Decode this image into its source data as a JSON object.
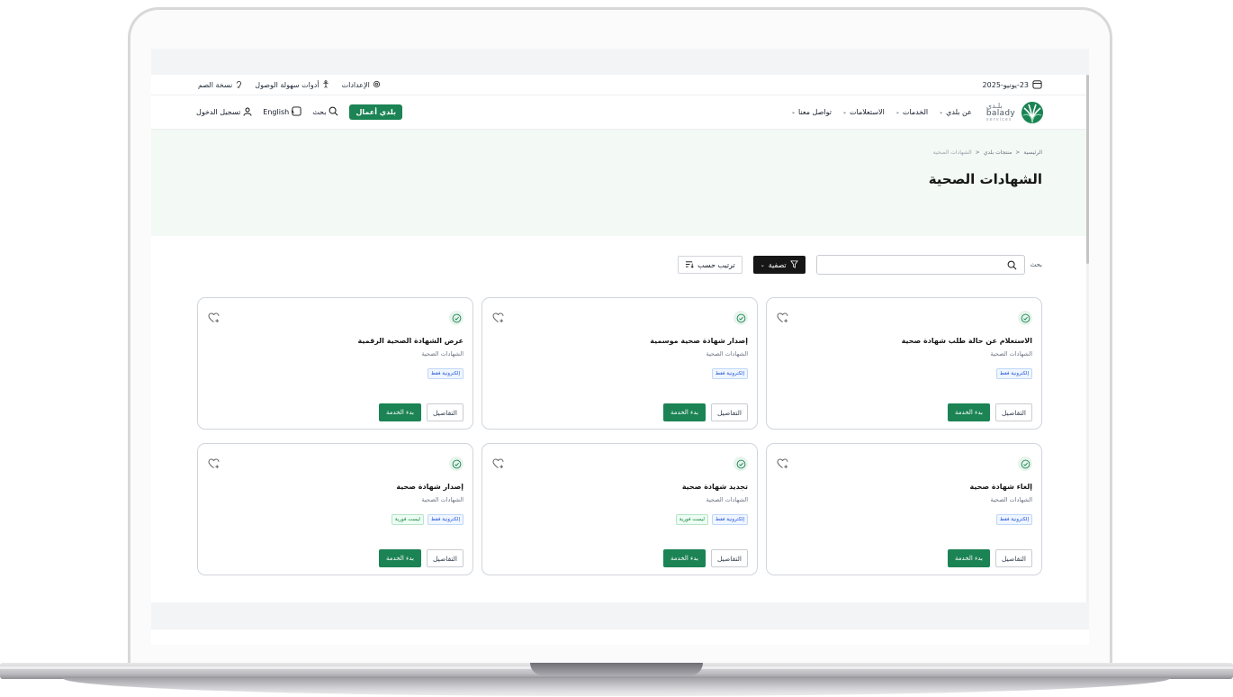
{
  "utility": {
    "date": "23-يونيو-2025",
    "settings": "الإعدادات",
    "accessibility": "أدوات سهولة الوصول",
    "screen_reader": "نسخة الصم"
  },
  "logo": {
    "ar": "بلـدي",
    "en": "balady",
    "sub": "services"
  },
  "nav": {
    "items": [
      {
        "label": "عن بلدي"
      },
      {
        "label": "الخدمات"
      },
      {
        "label": "الاستعلامات"
      },
      {
        "label": "تواصل معنا"
      }
    ],
    "business_button": "بلدي أعمال",
    "search": "بحث",
    "language": "English",
    "login": "تسجيل الدخول"
  },
  "breadcrumb": {
    "home": "الرئيسية",
    "products": "منتجات بلدي",
    "current": "الشهادات الصحية",
    "sep": "<"
  },
  "page_title": "الشهادات الصحية",
  "toolbar": {
    "search_label": "بحث",
    "search_placeholder": "",
    "filter": "تصفية",
    "sort": "ترتيب حسب"
  },
  "cards": [
    {
      "title": "الاستعلام عن حالة طلب شهادة صحية",
      "category": "الشهادات الصحية",
      "badges": [
        "إلكترونية فقط"
      ],
      "details": "التفاصيل",
      "start": "بدء الخدمة"
    },
    {
      "title": "إصدار شهادة صحية موسمية",
      "category": "الشهادات الصحية",
      "badges": [
        "إلكترونية فقط"
      ],
      "details": "التفاصيل",
      "start": "بدء الخدمة"
    },
    {
      "title": "عرض الشهادة الصحية الرقمية",
      "category": "الشهادات الصحية",
      "badges": [
        "إلكترونية فقط"
      ],
      "details": "التفاصيل",
      "start": "بدء الخدمة"
    },
    {
      "title": "إلغاء شهادة صحية",
      "category": "الشهادات الصحية",
      "badges": [
        "إلكترونية فقط"
      ],
      "details": "التفاصيل",
      "start": "بدء الخدمة"
    },
    {
      "title": "تجديد شهادة صحية",
      "category": "الشهادات الصحية",
      "badges": [
        "إلكترونية فقط",
        "ليست فورية"
      ],
      "details": "التفاصيل",
      "start": "بدء الخدمة"
    },
    {
      "title": "إصدار شهادة صحية",
      "category": "الشهادات الصحية",
      "badges": [
        "إلكترونية فقط",
        "ليست فورية"
      ],
      "details": "التفاصيل",
      "start": "بدء الخدمة"
    }
  ],
  "colors": {
    "primary": "#1b8354",
    "hero_bg": "#f3f9f4",
    "dark": "#161616"
  }
}
